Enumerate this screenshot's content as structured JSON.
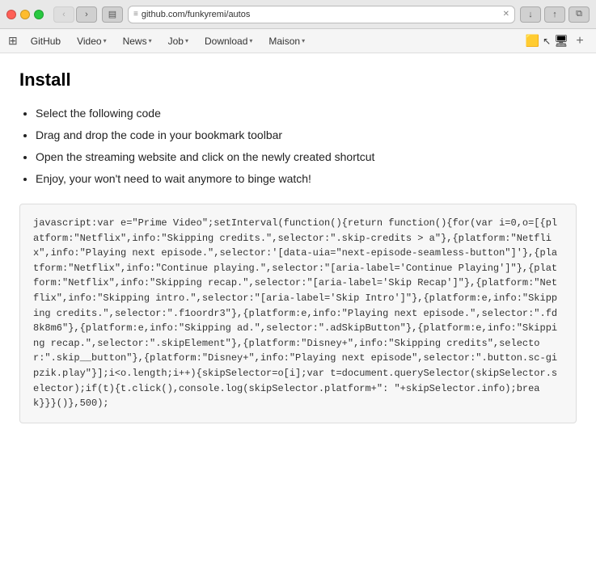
{
  "titlebar": {
    "url": "github.com/funkyremi/autos",
    "back_label": "‹",
    "forward_label": "›",
    "sidebar_label": "⊞",
    "share_label": "↑",
    "windows_label": "⧉",
    "download_label": "↓",
    "new_tab_label": "+"
  },
  "navbar": {
    "items": [
      {
        "label": "GitHub",
        "has_arrow": false
      },
      {
        "label": "Video",
        "has_arrow": true
      },
      {
        "label": "News",
        "has_arrow": true
      },
      {
        "label": "Job",
        "has_arrow": true
      },
      {
        "label": "Download",
        "has_arrow": true
      },
      {
        "label": "Maison",
        "has_arrow": true
      }
    ]
  },
  "page": {
    "title": "Install",
    "steps": [
      "Select the following code",
      "Drag and drop the code in your bookmark toolbar",
      "Open the streaming website and click on the newly created shortcut",
      "Enjoy, your won't need to wait anymore to binge watch!"
    ],
    "code": "javascript:var e=\"Prime Video\";setInterval(function(){return function(){for(var i=0,o=[{platform:\"Netflix\",info:\"Skipping credits.\",selector:\".skip-credits > a\"},{platform:\"Netflix\",info:\"Playing next episode.\",selector:'[data-uia=\"next-episode-seamless-button\"]'},{platform:\"Netflix\",info:\"Continue playing.\",selector:\"[aria-label='Continue Playing']\"},{platform:\"Netflix\",info:\"Skipping recap.\",selector:\"[aria-label='Skip Recap']\"},{platform:\"Netflix\",info:\"Skipping intro.\",selector:\"[aria-label='Skip Intro']\"},{platform:e,info:\"Skipping credits.\",selector:\".f1oordr3\"},{platform:e,info:\"Playing next episode.\",selector:\".fd8k8m6\"},{platform:e,info:\"Skipping ad.\",selector:\".adSkipButton\"},{platform:e,info:\"Skipping recap.\",selector:\".skipElement\"},{platform:\"Disney+\",info:\"Skipping credits\",selector:\".skip__button\"},{platform:\"Disney+\",info:\"Playing next episode\",selector:\".button.sc-gipzik.play\"}];i<o.length;i++){skipSelector=o[i];var t=document.querySelector(skipSelector.selector);if(t){t.click(),console.log(skipSelector.platform+\": \"+skipSelector.info);break}}}()},500);"
  }
}
